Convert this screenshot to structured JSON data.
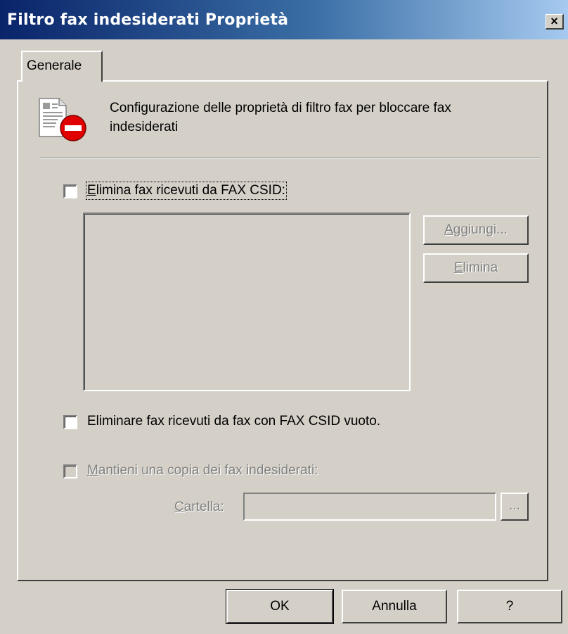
{
  "window": {
    "title": "Filtro fax indesiderati Proprietà",
    "close_glyph": "×"
  },
  "tabs": [
    {
      "label": "Generale",
      "selected": true
    }
  ],
  "header": {
    "icon": "fax-block-icon",
    "description": "Configurazione delle proprietà di filtro fax per bloccare fax indesiderati"
  },
  "csid_filter": {
    "checkbox_label": "Elimina fax ricevuti da FAX CSID:",
    "checked": false,
    "add_button": "Aggiungi...",
    "delete_button": "Elimina"
  },
  "empty_csid": {
    "checkbox_label": "Eliminare fax ricevuti da fax con FAX CSID vuoto.",
    "checked": false
  },
  "keep_copy": {
    "checkbox_label": "Mantieni una copia dei fax indesiderati:",
    "checked": false,
    "folder_label": "Cartella:",
    "folder_value": "",
    "browse_button": "..."
  },
  "footer": {
    "ok": "OK",
    "cancel": "Annulla",
    "help": "?"
  }
}
